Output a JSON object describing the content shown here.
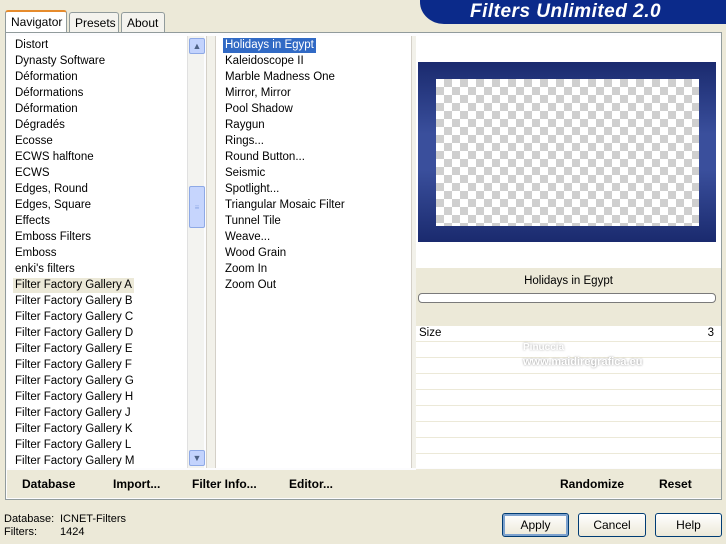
{
  "app": {
    "title": "Filters Unlimited 2.0"
  },
  "tabs": [
    {
      "label": "Navigator",
      "active": true
    },
    {
      "label": "Presets",
      "active": false
    },
    {
      "label": "About",
      "active": false
    }
  ],
  "categories": {
    "selected": "Filter Factory Gallery A",
    "items": [
      "Distort",
      "Dynasty Software",
      "Déformation",
      "Déformations",
      "Déformation",
      "Dégradés",
      "Ecosse",
      "ECWS halftone",
      "ECWS",
      "Edges, Round",
      "Edges, Square",
      "Effects",
      "Emboss Filters",
      "Emboss",
      "enki's filters",
      "Filter Factory Gallery A",
      "Filter Factory Gallery B",
      "Filter Factory Gallery C",
      "Filter Factory Gallery D",
      "Filter Factory Gallery E",
      "Filter Factory Gallery F",
      "Filter Factory Gallery G",
      "Filter Factory Gallery H",
      "Filter Factory Gallery J",
      "Filter Factory Gallery K",
      "Filter Factory Gallery L",
      "Filter Factory Gallery M"
    ]
  },
  "filters": {
    "selected": "Holidays in Egypt",
    "items": [
      "Holidays in Egypt",
      "Kaleidoscope II",
      "Marble Madness One",
      "Mirror, Mirror",
      "Pool Shadow",
      "Raygun",
      "Rings...",
      "Round Button...",
      "Seismic",
      "Spotlight...",
      "Triangular Mosaic Filter",
      "Tunnel Tile",
      "Weave...",
      "Wood Grain",
      "Zoom In",
      "Zoom Out"
    ]
  },
  "preview": {
    "filter_name": "Holidays in Egypt",
    "frame_color": "#2e3f86"
  },
  "parameters": [
    {
      "name": "Size",
      "value": "3"
    }
  ],
  "toolbar": {
    "database": "Database",
    "import": "Import...",
    "filter_info": "Filter Info...",
    "editor": "Editor...",
    "randomize": "Randomize",
    "reset": "Reset"
  },
  "status": {
    "database_label": "Database:",
    "database_value": "ICNET-Filters",
    "filters_label": "Filters:",
    "filters_value": "1424"
  },
  "buttons": {
    "apply": "Apply",
    "cancel": "Cancel",
    "help": "Help"
  },
  "watermark": {
    "name": "Pinuccia",
    "url": "www.maidiregrafica.eu"
  }
}
